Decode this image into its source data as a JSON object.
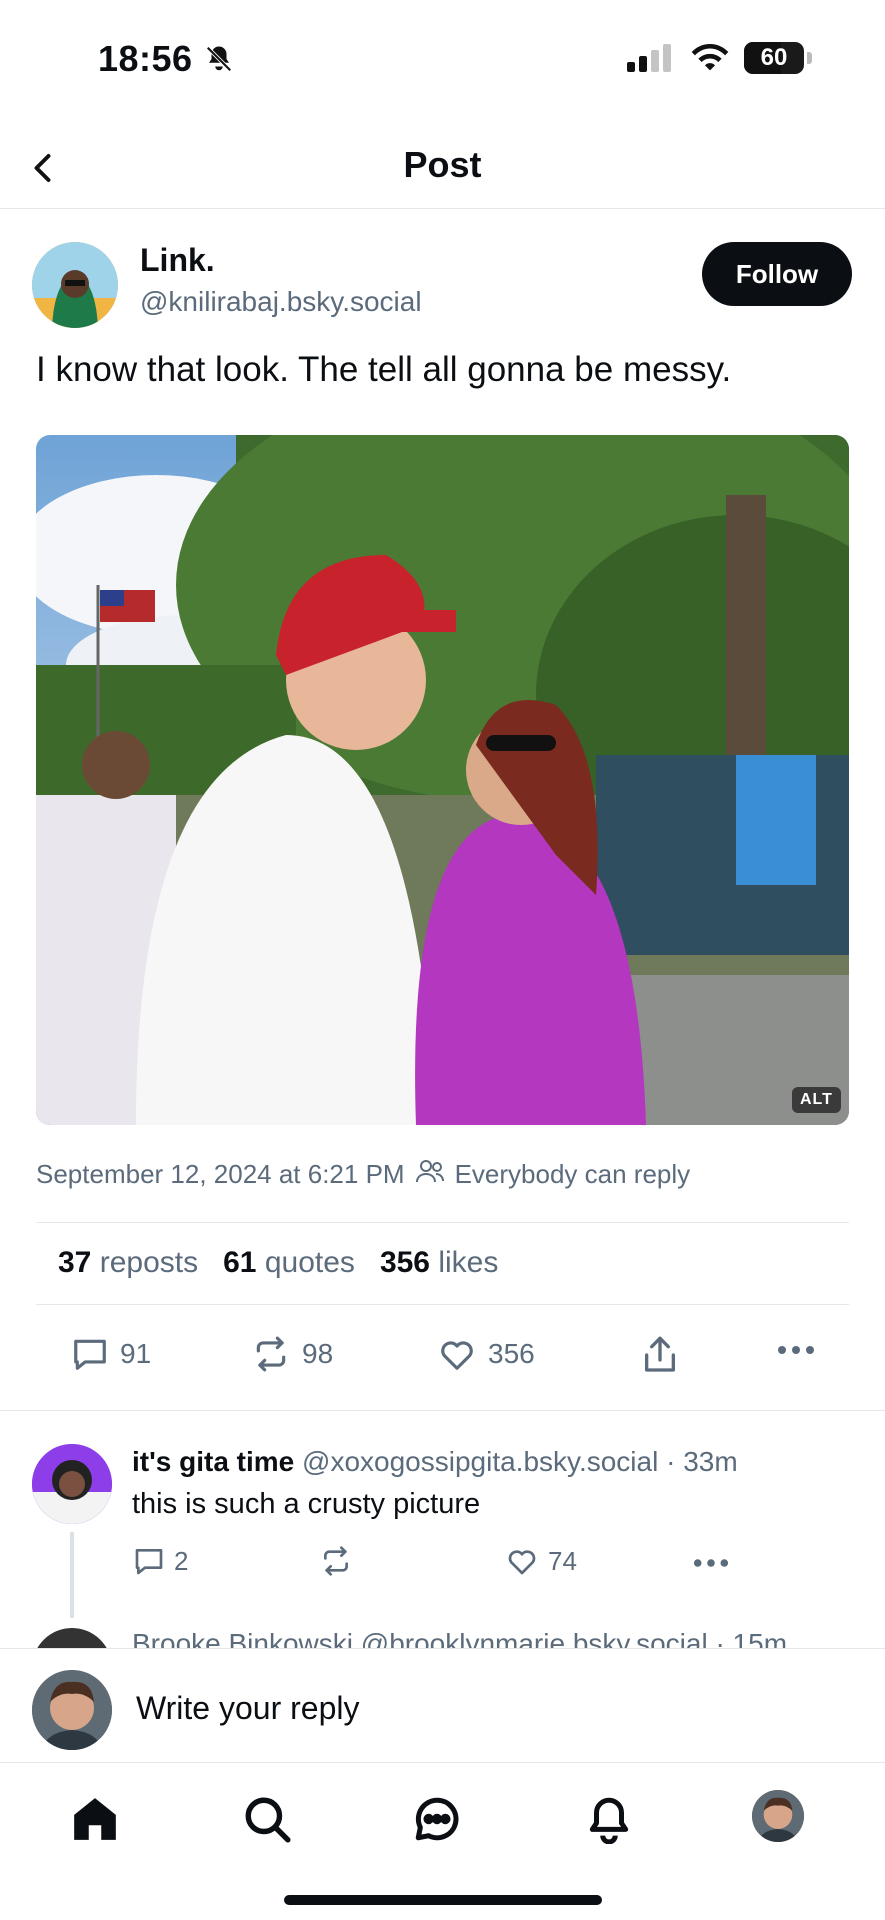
{
  "status_bar": {
    "time": "18:56",
    "battery": "60"
  },
  "header": {
    "title": "Post"
  },
  "post": {
    "author_name": "Link.",
    "author_handle": "@knilirabaj.bsky.social",
    "follow_label": "Follow",
    "text": "I know that look. The tell all gonna be messy.",
    "image_alt_badge": "ALT",
    "timestamp": "September 12, 2024 at 6:21 PM",
    "reply_setting": "Everybody can reply",
    "stats": {
      "reposts_count": "37",
      "reposts_label": "reposts",
      "quotes_count": "61",
      "quotes_label": "quotes",
      "likes_count": "356",
      "likes_label": "likes"
    },
    "actions": {
      "replies": "91",
      "reposts": "98",
      "likes": "356"
    }
  },
  "replies": [
    {
      "name": "it's gita time",
      "handle": "@xoxogossipgita.bsky.social",
      "age": "· 33m",
      "text": "this is such a crusty picture",
      "reply_count": "2",
      "like_count": "74"
    },
    {
      "name": "Brooke Binkowski",
      "handle": "@brooklynmarie.bsky.social · 15m"
    }
  ],
  "compose": {
    "placeholder": "Write your reply"
  },
  "icons": {
    "back": "chevron-left-icon",
    "bell_muted": "bell-slash-icon",
    "reply": "comment-icon",
    "repost": "repost-icon",
    "like": "heart-icon",
    "share": "share-icon",
    "more": "ellipsis-icon",
    "tabs": [
      "home-icon",
      "search-icon",
      "chat-icon",
      "notifications-icon",
      "profile-avatar"
    ]
  },
  "colors": {
    "accent_text": "#5b6b7b",
    "follow_bg": "#0b0f14"
  }
}
